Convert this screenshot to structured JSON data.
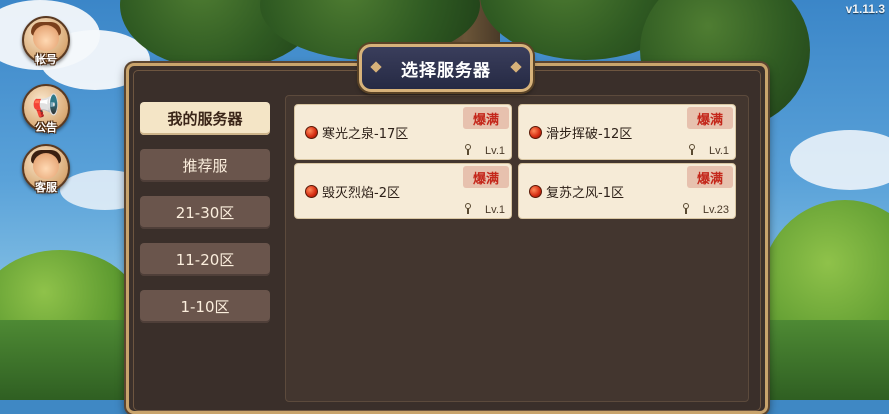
{
  "version": "v1.11.3",
  "side_buttons": [
    {
      "label": "帐号",
      "icon": "account-avatar-icon"
    },
    {
      "label": "公告",
      "icon": "megaphone-icon"
    },
    {
      "label": "客服",
      "icon": "support-avatar-icon"
    }
  ],
  "dialog": {
    "title": "选择服务器"
  },
  "tabs": [
    {
      "label": "我的服务器",
      "active": true
    },
    {
      "label": "推荐服",
      "active": false
    },
    {
      "label": "21-30区",
      "active": false
    },
    {
      "label": "11-20区",
      "active": false
    },
    {
      "label": "1-10区",
      "active": false
    }
  ],
  "servers": [
    {
      "name": "寒光之泉-17区",
      "badge": "爆满",
      "level": "Lv.1"
    },
    {
      "name": "滑步挥破-12区",
      "badge": "爆满",
      "level": "Lv.1"
    },
    {
      "name": "毁灭烈焰-2区",
      "badge": "爆满",
      "level": "Lv.1"
    },
    {
      "name": "复苏之风-1区",
      "badge": "爆满",
      "level": "Lv.23"
    }
  ],
  "colors": {
    "status_full": "#d42a10",
    "badge_text": "#c4271b",
    "active_tab": "#f4e5c6",
    "panel": "#3b302b",
    "frame_gold": "#c9a46c"
  }
}
